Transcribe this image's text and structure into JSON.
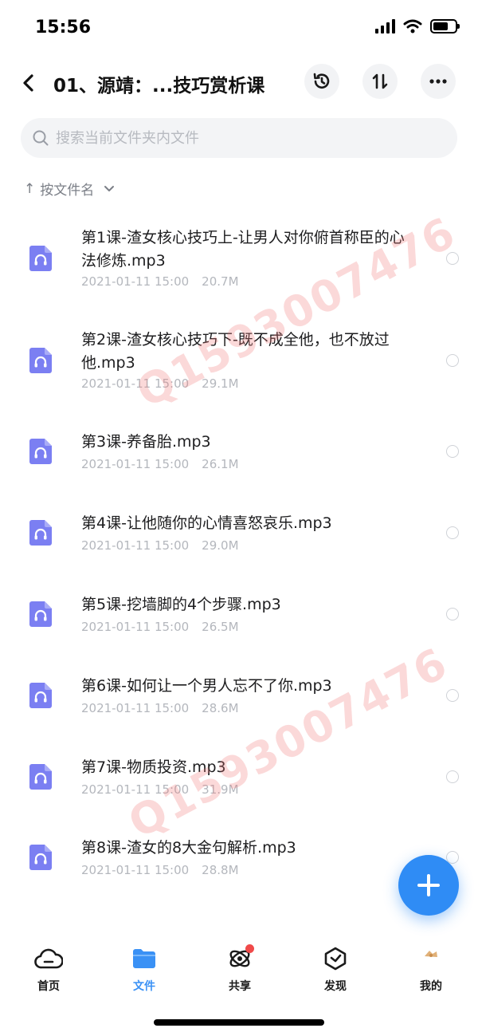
{
  "status_bar": {
    "time": "15:56"
  },
  "header": {
    "title": "01、源靖：...技巧赏析课",
    "back_icon": "chevron-left-icon",
    "actions": [
      "history-icon",
      "sort-arrows-icon",
      "more-icon"
    ]
  },
  "search": {
    "placeholder": "搜索当前文件夹内文件"
  },
  "sort": {
    "label": "按文件名",
    "arrow": "↑"
  },
  "files": [
    {
      "name": "第1课-渣女核心技巧上-让男人对你俯首称臣的心法修炼.mp3",
      "date": "2021-01-11 15:00",
      "size": "20.7M"
    },
    {
      "name": "第2课-渣女核心技巧下-既不成全他，也不放过他.mp3",
      "date": "2021-01-11 15:00",
      "size": "29.1M"
    },
    {
      "name": "第3课-养备胎.mp3",
      "date": "2021-01-11 15:00",
      "size": "26.1M"
    },
    {
      "name": "第4课-让他随你的心情喜怒哀乐.mp3",
      "date": "2021-01-11 15:00",
      "size": "29.0M"
    },
    {
      "name": "第5课-挖墙脚的4个步骤.mp3",
      "date": "2021-01-11 15:00",
      "size": "26.5M"
    },
    {
      "name": "第6课-如何让一个男人忘不了你.mp3",
      "date": "2021-01-11 15:00",
      "size": "28.6M"
    },
    {
      "name": "第7课-物质投资.mp3",
      "date": "2021-01-11 15:00",
      "size": "31.9M"
    },
    {
      "name": "第8课-渣女的8大金句解析.mp3",
      "date": "2021-01-11 15:00",
      "size": "28.8M"
    }
  ],
  "watermark": {
    "text": "Q1593007476"
  },
  "tabs": [
    {
      "label": "首页",
      "icon": "cloud-face-icon",
      "active": false
    },
    {
      "label": "文件",
      "icon": "folder-icon",
      "active": true
    },
    {
      "label": "共享",
      "icon": "orbit-icon",
      "active": false,
      "badge": true
    },
    {
      "label": "发现",
      "icon": "compass-icon",
      "active": false
    },
    {
      "label": "我的",
      "icon": "avatar-icon",
      "active": false
    }
  ],
  "colors": {
    "accent": "#3a91f5",
    "file_icon": "#7b7ff2",
    "fab": "#2f8cf5",
    "badge": "#f04a4a"
  }
}
